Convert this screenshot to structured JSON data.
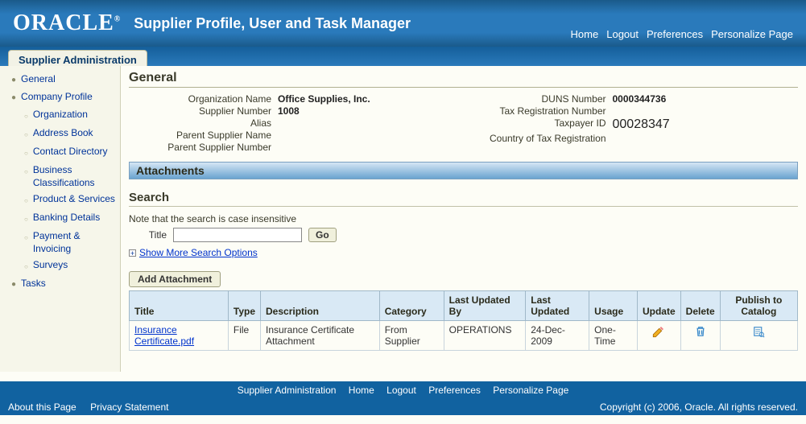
{
  "header": {
    "logo": "ORACLE",
    "app_title": "Supplier Profile, User and Task Manager"
  },
  "top_nav": {
    "home": "Home",
    "logout": "Logout",
    "preferences": "Preferences",
    "personalize": "Personalize Page"
  },
  "tab": {
    "label": "Supplier Administration"
  },
  "sidebar": {
    "general": "General",
    "company_profile": "Company Profile",
    "organization": "Organization",
    "address_book": "Address Book",
    "contact_directory": "Contact Directory",
    "business_classifications": "Business Classifications",
    "product_services": "Product & Services",
    "banking_details": "Banking Details",
    "payment_invoicing": "Payment & Invoicing",
    "surveys": "Surveys",
    "tasks": "Tasks"
  },
  "general": {
    "title": "General",
    "left": {
      "org_name_label": "Organization Name",
      "org_name": "Office Supplies, Inc.",
      "supplier_num_label": "Supplier Number",
      "supplier_num": "1008",
      "alias_label": "Alias",
      "alias": "",
      "parent_name_label": "Parent Supplier Name",
      "parent_name": "",
      "parent_num_label": "Parent Supplier Number",
      "parent_num": ""
    },
    "right": {
      "duns_label": "DUNS Number",
      "duns": "0000344736",
      "tax_reg_label": "Tax Registration Number",
      "tax_reg": "",
      "taxpayer_label": "Taxpayer ID",
      "taxpayer": "00028347",
      "country_label": "Country of Tax Registration",
      "country": ""
    }
  },
  "attachments": {
    "title": "Attachments",
    "search_title": "Search",
    "note": "Note that the search is case insensitive",
    "title_label": "Title",
    "go": "Go",
    "show_more": "Show More Search Options",
    "add": "Add Attachment",
    "cols": {
      "title": "Title",
      "type": "Type",
      "description": "Description",
      "category": "Category",
      "updated_by": "Last Updated By",
      "updated": "Last Updated",
      "usage": "Usage",
      "update": "Update",
      "delete": "Delete",
      "publish": "Publish to Catalog"
    },
    "rows": [
      {
        "title_link": "Insurance Certificate.pdf",
        "type": "File",
        "description": "Insurance Certificate Attachment",
        "category": "From Supplier",
        "updated_by": "OPERATIONS",
        "updated": "24-Dec-2009",
        "usage": "One-Time"
      }
    ]
  },
  "footer_links": {
    "supplier_admin": "Supplier Administration",
    "home": "Home",
    "logout": "Logout",
    "preferences": "Preferences",
    "personalize": "Personalize Page"
  },
  "footer": {
    "about": "About this Page",
    "privacy": "Privacy Statement",
    "copyright": "Copyright (c) 2006, Oracle. All rights reserved."
  }
}
